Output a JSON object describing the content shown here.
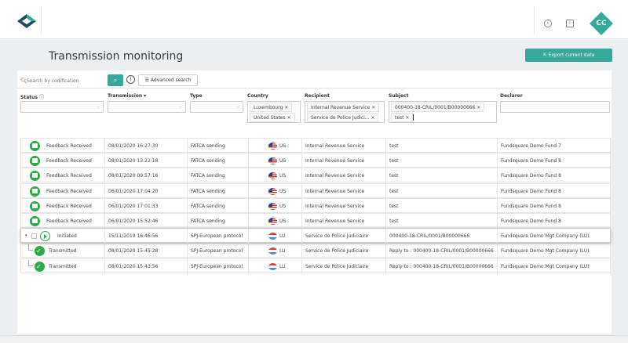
{
  "header": {
    "info_icon": "info-icon",
    "news_icon": "newspaper-icon",
    "user_initials": "CC",
    "colors": {
      "accent": "#35a99b",
      "logo_dark": "#1f4e5f"
    }
  },
  "page": {
    "title": "Transmission monitoring",
    "export_label": "Export current data"
  },
  "search": {
    "placeholder": "Search by codification",
    "advanced_label": "Advanced search"
  },
  "filters": {
    "status": {
      "label": "Status"
    },
    "transmission": {
      "label": "Transmission"
    },
    "type": {
      "label": "Type"
    },
    "country": {
      "label": "Country",
      "tags": [
        "Luxembourg ×",
        "United States ×"
      ]
    },
    "recipient": {
      "label": "Recipient",
      "tags": [
        "Internal Revenue Service ×",
        "Service de Police Judici... ×"
      ]
    },
    "subject": {
      "label": "Subject",
      "tags": [
        "000400-18-CRIL/0001/B00000666 ×",
        "test ×"
      ]
    },
    "declarer": {
      "label": "Declarer"
    }
  },
  "rows": [
    {
      "status": "Feedback Received",
      "datetime": "08/01/2020 16:27:30",
      "type": "FATCA sending",
      "country": "US",
      "recipient": "Internal Revenue Service",
      "subject": "test",
      "declarer": "Fundsquare Demo Fund 7"
    },
    {
      "status": "Feedback Received",
      "datetime": "08/01/2020 13:22:18",
      "type": "FATCA sending",
      "country": "US",
      "recipient": "Internal Revenue Service",
      "subject": "test",
      "declarer": "Fundsquare Demo Fund 8"
    },
    {
      "status": "Feedback Received",
      "datetime": "08/01/2020 09:57:16",
      "type": "FATCA sending",
      "country": "US",
      "recipient": "Internal Revenue Service",
      "subject": "test",
      "declarer": "Fundsquare Demo Fund 8"
    },
    {
      "status": "Feedback Received",
      "datetime": "06/01/2020 17:04:20",
      "type": "FATCA sending",
      "country": "US",
      "recipient": "Internal Revenue Service",
      "subject": "test",
      "declarer": "Fundsquare Demo Fund 8"
    },
    {
      "status": "Feedback Received",
      "datetime": "06/01/2020 17:01:33",
      "type": "FATCA sending",
      "country": "US",
      "recipient": "Internal Revenue Service",
      "subject": "test",
      "declarer": "Fundsquare Demo Fund 8"
    },
    {
      "status": "Feedback Received",
      "datetime": "06/01/2020 15:52:46",
      "type": "FATCA sending",
      "country": "US",
      "recipient": "Internal Revenue Service",
      "subject": "test",
      "declarer": "Fundsquare Demo Fund 8"
    },
    {
      "status": "Initiated",
      "datetime": "15/11/2019 16:46:56",
      "type": "SPJ-European protocol",
      "country": "LU",
      "recipient": "Service de Police Judiciaire",
      "subject": "000400-18-CRIL/0001/B00000666",
      "declarer": "Fundsquare Demo Mgt Company (LU)"
    },
    {
      "status": "Transmitted",
      "datetime": "08/01/2020 15:45:28",
      "type": "SPJ-European protocol",
      "country": "LU",
      "recipient": "Service de Police Judiciaire",
      "subject": "Reply to : 000400-18-CRIL/0001/B00000666",
      "declarer": "Fundsquare Demo Mgt Company (LU)"
    },
    {
      "status": "Transmitted",
      "datetime": "08/01/2020 15:43:56",
      "type": "SPJ-European protocol",
      "country": "LU",
      "recipient": "Service de Police Judiciaire",
      "subject": "Reply to : 000400-18-CRIL/0001/B00000666",
      "declarer": "Fundsquare Demo Mgt Company (LU)"
    }
  ]
}
